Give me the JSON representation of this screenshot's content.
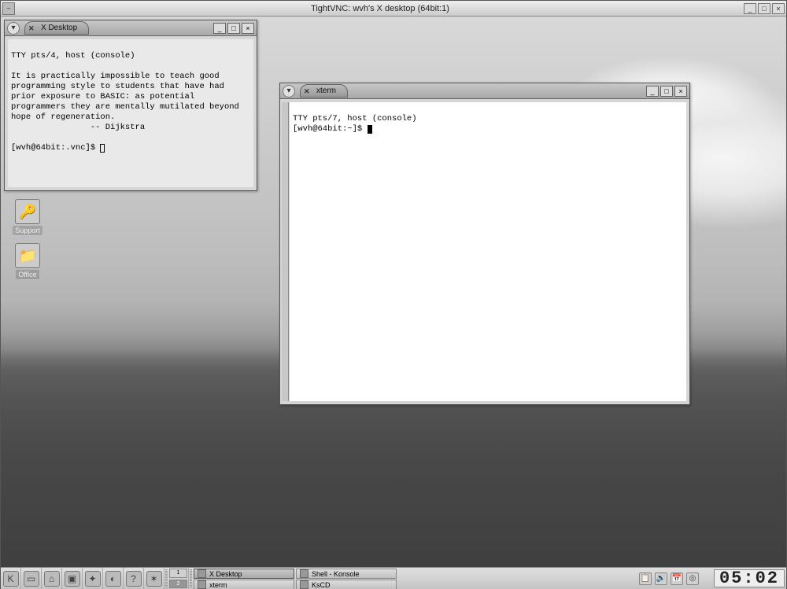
{
  "vnc": {
    "title": "TightVNC: wvh's X desktop (64bit:1)"
  },
  "desktop_icons": [
    {
      "name": "support",
      "label": "Support",
      "glyph": "🔑"
    },
    {
      "name": "office",
      "label": "Office",
      "glyph": "📁"
    }
  ],
  "windows": {
    "xdesktop": {
      "title": "X Desktop",
      "lines": {
        "l1": "TTY pts/4, host (console)",
        "blank1": "",
        "body": "It is practically impossible to teach good programming style to students that have had prior exposure to BASIC: as potential programmers they are mentally mutilated beyond hope of regeneration.",
        "attr": "                -- Dijkstra",
        "blank2": "",
        "prompt": "[wvh@64bit:.vnc]$ "
      }
    },
    "xterm": {
      "title": "xterm",
      "lines": {
        "l1": "TTY pts/7, host (console)",
        "prompt": "[wvh@64bit:~]$ "
      }
    }
  },
  "panel": {
    "launchers": [
      {
        "name": "kmenu",
        "glyph": "K"
      },
      {
        "name": "desktop",
        "glyph": "▭"
      },
      {
        "name": "home",
        "glyph": "⌂"
      },
      {
        "name": "konsole",
        "glyph": "▣"
      },
      {
        "name": "konqueror",
        "glyph": "✦"
      },
      {
        "name": "firefox",
        "glyph": "◐"
      },
      {
        "name": "help",
        "glyph": "?"
      },
      {
        "name": "gnu",
        "glyph": "✶"
      }
    ],
    "pager": [
      "1",
      "2"
    ],
    "tasks_col1": [
      {
        "label": "X Desktop",
        "active": true
      },
      {
        "label": "xterm",
        "active": false
      }
    ],
    "tasks_col2": [
      {
        "label": "Shell - Konsole",
        "active": false
      },
      {
        "label": "KsCD",
        "active": false
      }
    ],
    "tray": [
      {
        "name": "klipper",
        "glyph": "📋"
      },
      {
        "name": "volume",
        "glyph": "🔊"
      },
      {
        "name": "korganizer",
        "glyph": "📅"
      },
      {
        "name": "suse",
        "glyph": "◎"
      }
    ],
    "clock": "05:02"
  }
}
